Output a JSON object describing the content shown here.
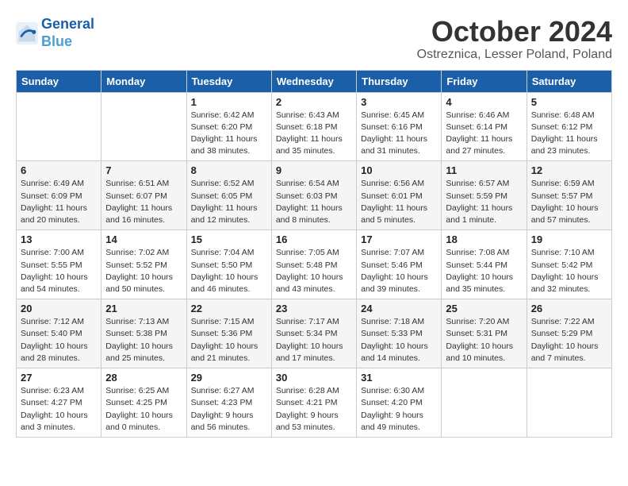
{
  "logo": {
    "line1": "General",
    "line2": "Blue"
  },
  "title": "October 2024",
  "subtitle": "Ostreznica, Lesser Poland, Poland",
  "weekdays": [
    "Sunday",
    "Monday",
    "Tuesday",
    "Wednesday",
    "Thursday",
    "Friday",
    "Saturday"
  ],
  "weeks": [
    [
      {
        "day": "",
        "sunrise": "",
        "sunset": "",
        "daylight": ""
      },
      {
        "day": "",
        "sunrise": "",
        "sunset": "",
        "daylight": ""
      },
      {
        "day": "1",
        "sunrise": "Sunrise: 6:42 AM",
        "sunset": "Sunset: 6:20 PM",
        "daylight": "Daylight: 11 hours and 38 minutes."
      },
      {
        "day": "2",
        "sunrise": "Sunrise: 6:43 AM",
        "sunset": "Sunset: 6:18 PM",
        "daylight": "Daylight: 11 hours and 35 minutes."
      },
      {
        "day": "3",
        "sunrise": "Sunrise: 6:45 AM",
        "sunset": "Sunset: 6:16 PM",
        "daylight": "Daylight: 11 hours and 31 minutes."
      },
      {
        "day": "4",
        "sunrise": "Sunrise: 6:46 AM",
        "sunset": "Sunset: 6:14 PM",
        "daylight": "Daylight: 11 hours and 27 minutes."
      },
      {
        "day": "5",
        "sunrise": "Sunrise: 6:48 AM",
        "sunset": "Sunset: 6:12 PM",
        "daylight": "Daylight: 11 hours and 23 minutes."
      }
    ],
    [
      {
        "day": "6",
        "sunrise": "Sunrise: 6:49 AM",
        "sunset": "Sunset: 6:09 PM",
        "daylight": "Daylight: 11 hours and 20 minutes."
      },
      {
        "day": "7",
        "sunrise": "Sunrise: 6:51 AM",
        "sunset": "Sunset: 6:07 PM",
        "daylight": "Daylight: 11 hours and 16 minutes."
      },
      {
        "day": "8",
        "sunrise": "Sunrise: 6:52 AM",
        "sunset": "Sunset: 6:05 PM",
        "daylight": "Daylight: 11 hours and 12 minutes."
      },
      {
        "day": "9",
        "sunrise": "Sunrise: 6:54 AM",
        "sunset": "Sunset: 6:03 PM",
        "daylight": "Daylight: 11 hours and 8 minutes."
      },
      {
        "day": "10",
        "sunrise": "Sunrise: 6:56 AM",
        "sunset": "Sunset: 6:01 PM",
        "daylight": "Daylight: 11 hours and 5 minutes."
      },
      {
        "day": "11",
        "sunrise": "Sunrise: 6:57 AM",
        "sunset": "Sunset: 5:59 PM",
        "daylight": "Daylight: 11 hours and 1 minute."
      },
      {
        "day": "12",
        "sunrise": "Sunrise: 6:59 AM",
        "sunset": "Sunset: 5:57 PM",
        "daylight": "Daylight: 10 hours and 57 minutes."
      }
    ],
    [
      {
        "day": "13",
        "sunrise": "Sunrise: 7:00 AM",
        "sunset": "Sunset: 5:55 PM",
        "daylight": "Daylight: 10 hours and 54 minutes."
      },
      {
        "day": "14",
        "sunrise": "Sunrise: 7:02 AM",
        "sunset": "Sunset: 5:52 PM",
        "daylight": "Daylight: 10 hours and 50 minutes."
      },
      {
        "day": "15",
        "sunrise": "Sunrise: 7:04 AM",
        "sunset": "Sunset: 5:50 PM",
        "daylight": "Daylight: 10 hours and 46 minutes."
      },
      {
        "day": "16",
        "sunrise": "Sunrise: 7:05 AM",
        "sunset": "Sunset: 5:48 PM",
        "daylight": "Daylight: 10 hours and 43 minutes."
      },
      {
        "day": "17",
        "sunrise": "Sunrise: 7:07 AM",
        "sunset": "Sunset: 5:46 PM",
        "daylight": "Daylight: 10 hours and 39 minutes."
      },
      {
        "day": "18",
        "sunrise": "Sunrise: 7:08 AM",
        "sunset": "Sunset: 5:44 PM",
        "daylight": "Daylight: 10 hours and 35 minutes."
      },
      {
        "day": "19",
        "sunrise": "Sunrise: 7:10 AM",
        "sunset": "Sunset: 5:42 PM",
        "daylight": "Daylight: 10 hours and 32 minutes."
      }
    ],
    [
      {
        "day": "20",
        "sunrise": "Sunrise: 7:12 AM",
        "sunset": "Sunset: 5:40 PM",
        "daylight": "Daylight: 10 hours and 28 minutes."
      },
      {
        "day": "21",
        "sunrise": "Sunrise: 7:13 AM",
        "sunset": "Sunset: 5:38 PM",
        "daylight": "Daylight: 10 hours and 25 minutes."
      },
      {
        "day": "22",
        "sunrise": "Sunrise: 7:15 AM",
        "sunset": "Sunset: 5:36 PM",
        "daylight": "Daylight: 10 hours and 21 minutes."
      },
      {
        "day": "23",
        "sunrise": "Sunrise: 7:17 AM",
        "sunset": "Sunset: 5:34 PM",
        "daylight": "Daylight: 10 hours and 17 minutes."
      },
      {
        "day": "24",
        "sunrise": "Sunrise: 7:18 AM",
        "sunset": "Sunset: 5:33 PM",
        "daylight": "Daylight: 10 hours and 14 minutes."
      },
      {
        "day": "25",
        "sunrise": "Sunrise: 7:20 AM",
        "sunset": "Sunset: 5:31 PM",
        "daylight": "Daylight: 10 hours and 10 minutes."
      },
      {
        "day": "26",
        "sunrise": "Sunrise: 7:22 AM",
        "sunset": "Sunset: 5:29 PM",
        "daylight": "Daylight: 10 hours and 7 minutes."
      }
    ],
    [
      {
        "day": "27",
        "sunrise": "Sunrise: 6:23 AM",
        "sunset": "Sunset: 4:27 PM",
        "daylight": "Daylight: 10 hours and 3 minutes."
      },
      {
        "day": "28",
        "sunrise": "Sunrise: 6:25 AM",
        "sunset": "Sunset: 4:25 PM",
        "daylight": "Daylight: 10 hours and 0 minutes."
      },
      {
        "day": "29",
        "sunrise": "Sunrise: 6:27 AM",
        "sunset": "Sunset: 4:23 PM",
        "daylight": "Daylight: 9 hours and 56 minutes."
      },
      {
        "day": "30",
        "sunrise": "Sunrise: 6:28 AM",
        "sunset": "Sunset: 4:21 PM",
        "daylight": "Daylight: 9 hours and 53 minutes."
      },
      {
        "day": "31",
        "sunrise": "Sunrise: 6:30 AM",
        "sunset": "Sunset: 4:20 PM",
        "daylight": "Daylight: 9 hours and 49 minutes."
      },
      {
        "day": "",
        "sunrise": "",
        "sunset": "",
        "daylight": ""
      },
      {
        "day": "",
        "sunrise": "",
        "sunset": "",
        "daylight": ""
      }
    ]
  ]
}
